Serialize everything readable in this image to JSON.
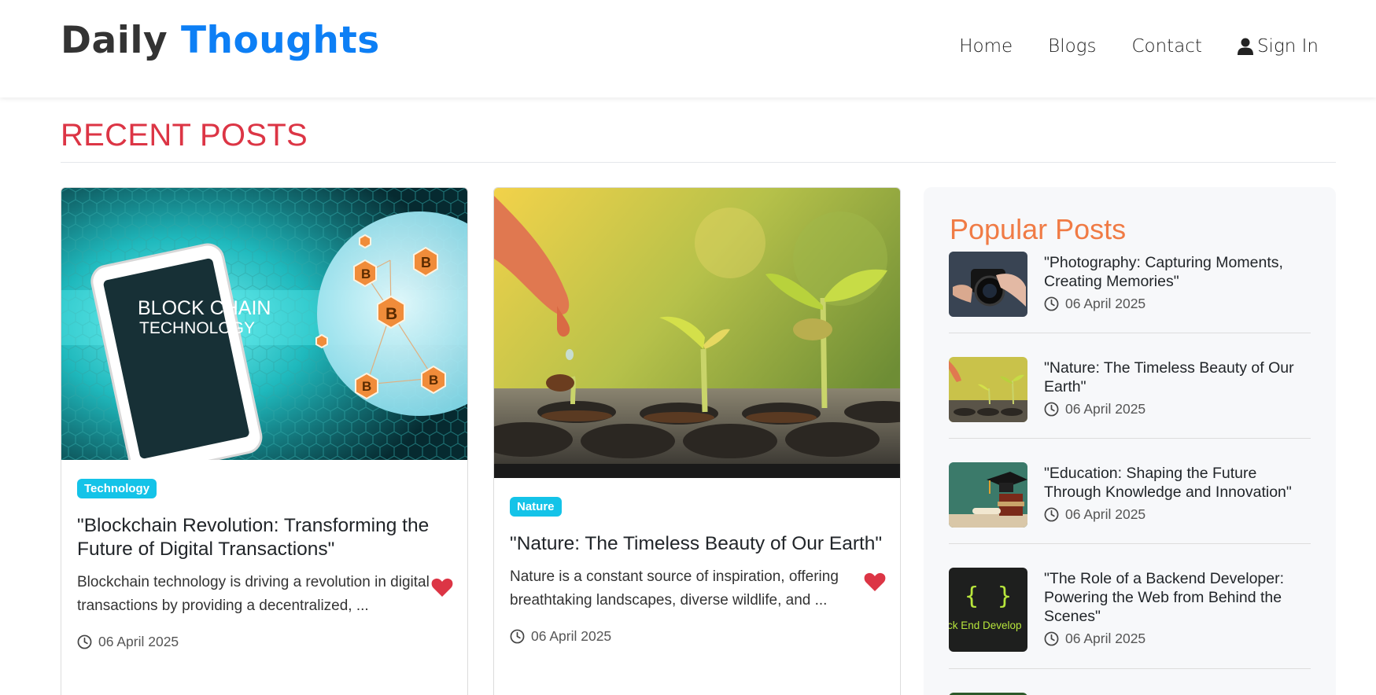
{
  "brand": {
    "part1": "Daily",
    "part2": "Thoughts"
  },
  "nav": {
    "home": "Home",
    "blogs": "Blogs",
    "contact": "Contact",
    "signin": "Sign In"
  },
  "section": {
    "title": "RECENT POSTS"
  },
  "posts": [
    {
      "image_text_line1": "BLOCK CHAIN",
      "image_text_line2": "TECHNOLOGY",
      "category": "Technology",
      "title": "\"Blockchain Revolution: Transforming the Future of Digital Transactions\"",
      "excerpt": "Blockchain technology is driving a revolution in digital transactions by providing a decentralized, ...",
      "date": "06 April 2025"
    },
    {
      "category": "Nature",
      "title": "\"Nature: The Timeless Beauty of Our Earth\"",
      "excerpt": "Nature is a constant source of inspiration, offering breathtaking landscapes, diverse wildlife, and ...",
      "date": "06 April 2025"
    }
  ],
  "sidebar": {
    "title": "Popular Posts",
    "items": [
      {
        "title": "\"Photography: Capturing Moments, Creating Memories\"",
        "date": "06 April 2025",
        "thumb": "camera"
      },
      {
        "title": "\"Nature: The Timeless Beauty of Our Earth\"",
        "date": "06 April 2025",
        "thumb": "seedlings"
      },
      {
        "title": "\"Education: Shaping the Future Through Knowledge and Innovation\"",
        "date": "06 April 2025",
        "thumb": "graduation-cap"
      },
      {
        "title": "\"The Role of a Backend Developer: Powering the Web from Behind the Scenes\"",
        "date": "06 April 2025",
        "thumb": "code-braces",
        "thumb_text": "ck End Develop"
      }
    ]
  },
  "colors": {
    "accent_blue": "#0d7ff5",
    "recent_red": "#dc3545",
    "popular_orange": "#f07b45",
    "badge_cyan": "#14c3e8",
    "heart_red": "#dc3545"
  }
}
